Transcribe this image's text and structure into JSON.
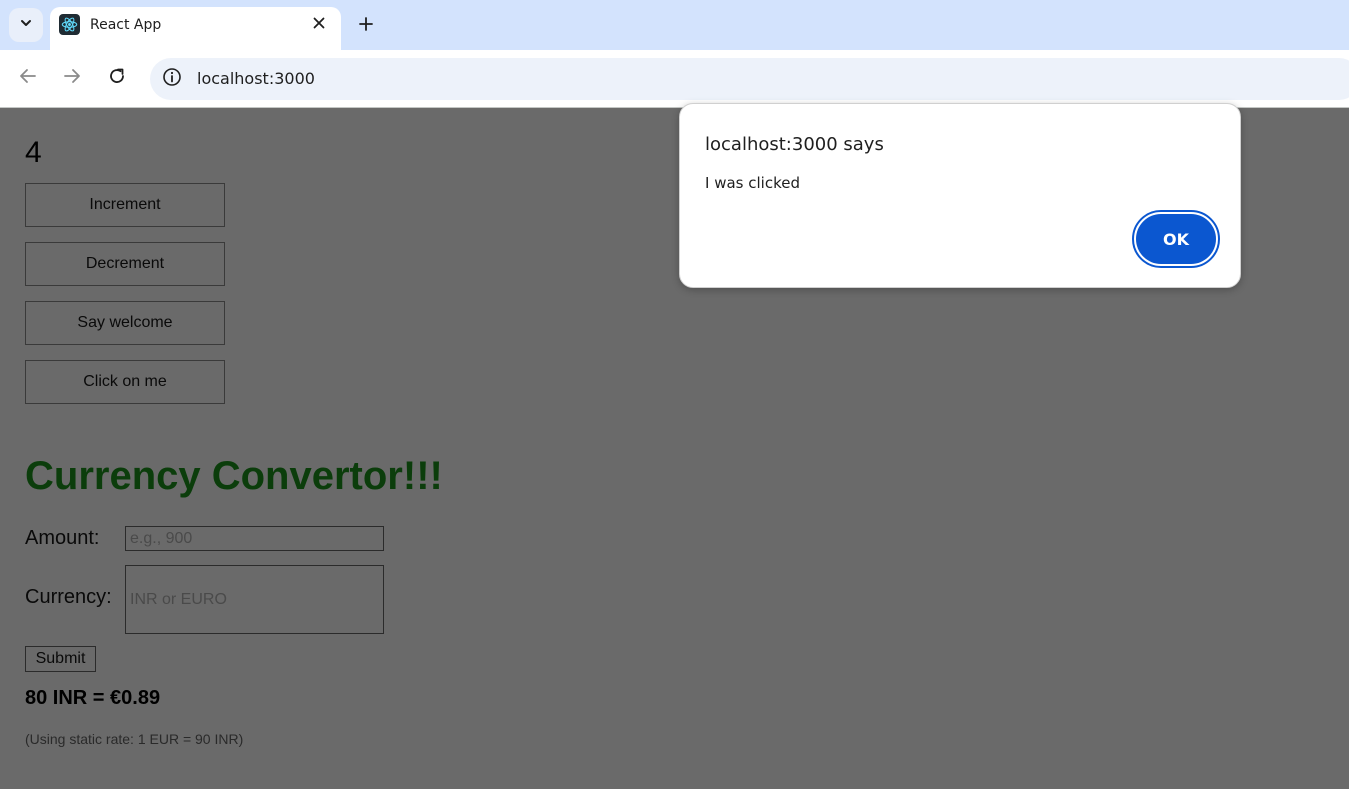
{
  "browser": {
    "tab_title": "React App",
    "url": "localhost:3000"
  },
  "counter": {
    "value": "4",
    "buttons": [
      "Increment",
      "Decrement",
      "Say welcome",
      "Click on me"
    ]
  },
  "converter": {
    "heading": "Currency Convertor!!!",
    "amount_label": "Amount:",
    "amount_placeholder": "e.g., 900",
    "currency_label": "Currency:",
    "currency_placeholder": "INR or EURO",
    "submit_label": "Submit",
    "result": "80 INR = €0.89",
    "note": "(Using static rate: 1 EUR = 90 INR)"
  },
  "dialog": {
    "title": "localhost:3000 says",
    "message": "I was clicked",
    "ok_label": "OK"
  },
  "colors": {
    "heading": "#0b3d0b",
    "ok_button": "#0b57d0",
    "page_dimmed": "#6a6a6a"
  }
}
